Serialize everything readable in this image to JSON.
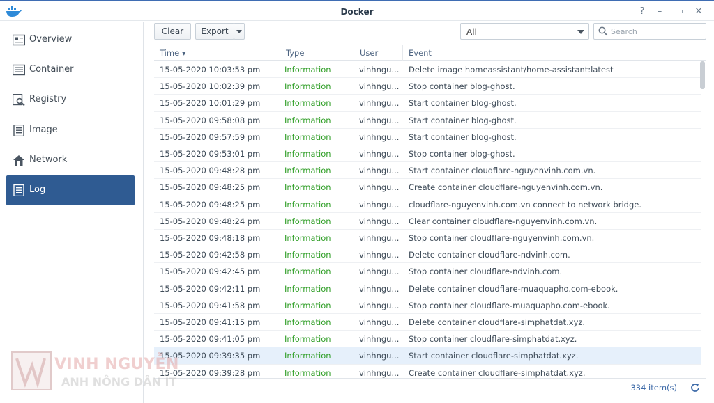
{
  "window": {
    "title": "Docker"
  },
  "titlebar_controls": [
    "?",
    "–",
    "▭",
    "✕"
  ],
  "sidebar": {
    "items": [
      {
        "label": "Overview",
        "icon": "overview-icon"
      },
      {
        "label": "Container",
        "icon": "container-icon"
      },
      {
        "label": "Registry",
        "icon": "registry-icon"
      },
      {
        "label": "Image",
        "icon": "image-icon"
      },
      {
        "label": "Network",
        "icon": "network-icon"
      },
      {
        "label": "Log",
        "icon": "log-icon",
        "active": true
      }
    ]
  },
  "toolbar": {
    "clear_label": "Clear",
    "export_label": "Export",
    "filter_value": "All",
    "search_placeholder": "Search"
  },
  "table": {
    "columns": [
      "Time",
      "Type",
      "User",
      "Event"
    ],
    "sort_indicator": "▾",
    "rows": [
      {
        "time": "15-05-2020 10:03:53 pm",
        "type": "Information",
        "user": "vinhngu...",
        "event": "Delete image homeassistant/home-assistant:latest"
      },
      {
        "time": "15-05-2020 10:02:39 pm",
        "type": "Information",
        "user": "vinhngu...",
        "event": "Stop container blog-ghost."
      },
      {
        "time": "15-05-2020 10:01:29 pm",
        "type": "Information",
        "user": "vinhngu...",
        "event": "Start container blog-ghost."
      },
      {
        "time": "15-05-2020 09:58:08 pm",
        "type": "Information",
        "user": "vinhngu...",
        "event": "Start container blog-ghost."
      },
      {
        "time": "15-05-2020 09:57:59 pm",
        "type": "Information",
        "user": "vinhngu...",
        "event": "Start container blog-ghost."
      },
      {
        "time": "15-05-2020 09:53:01 pm",
        "type": "Information",
        "user": "vinhngu...",
        "event": "Stop container blog-ghost."
      },
      {
        "time": "15-05-2020 09:48:28 pm",
        "type": "Information",
        "user": "vinhngu...",
        "event": "Start container cloudflare-nguyenvinh.com.vn."
      },
      {
        "time": "15-05-2020 09:48:25 pm",
        "type": "Information",
        "user": "vinhngu...",
        "event": "Create container cloudflare-nguyenvinh.com.vn."
      },
      {
        "time": "15-05-2020 09:48:25 pm",
        "type": "Information",
        "user": "vinhngu...",
        "event": "cloudflare-nguyenvinh.com.vn connect to network bridge."
      },
      {
        "time": "15-05-2020 09:48:24 pm",
        "type": "Information",
        "user": "vinhngu...",
        "event": "Clear container cloudflare-nguyenvinh.com.vn."
      },
      {
        "time": "15-05-2020 09:48:18 pm",
        "type": "Information",
        "user": "vinhngu...",
        "event": "Stop container cloudflare-nguyenvinh.com.vn."
      },
      {
        "time": "15-05-2020 09:42:58 pm",
        "type": "Information",
        "user": "vinhngu...",
        "event": "Delete container cloudflare-ndvinh.com."
      },
      {
        "time": "15-05-2020 09:42:45 pm",
        "type": "Information",
        "user": "vinhngu...",
        "event": "Stop container cloudflare-ndvinh.com."
      },
      {
        "time": "15-05-2020 09:42:11 pm",
        "type": "Information",
        "user": "vinhngu...",
        "event": "Delete container cloudflare-muaquapho.com-ebook."
      },
      {
        "time": "15-05-2020 09:41:58 pm",
        "type": "Information",
        "user": "vinhngu...",
        "event": "Stop container cloudflare-muaquapho.com-ebook."
      },
      {
        "time": "15-05-2020 09:41:15 pm",
        "type": "Information",
        "user": "vinhngu...",
        "event": "Delete container cloudflare-simphatdat.xyz."
      },
      {
        "time": "15-05-2020 09:41:05 pm",
        "type": "Information",
        "user": "vinhngu...",
        "event": "Stop container cloudflare-simphatdat.xyz."
      },
      {
        "time": "15-05-2020 09:39:35 pm",
        "type": "Information",
        "user": "vinhngu...",
        "event": "Start container cloudflare-simphatdat.xyz.",
        "selected": true
      },
      {
        "time": "15-05-2020 09:39:28 pm",
        "type": "Information",
        "user": "vinhngu...",
        "event": "Create container cloudflare-simphatdat.xyz."
      }
    ]
  },
  "footer": {
    "count": "334 item(s)"
  },
  "watermark": {
    "line1": "VINH NGUYỄN",
    "line2": "ANH NÔNG DÂN IT"
  },
  "colors": {
    "accent": "#2f5b92",
    "info_green": "#2f9e26",
    "header_text": "#4d6481"
  }
}
